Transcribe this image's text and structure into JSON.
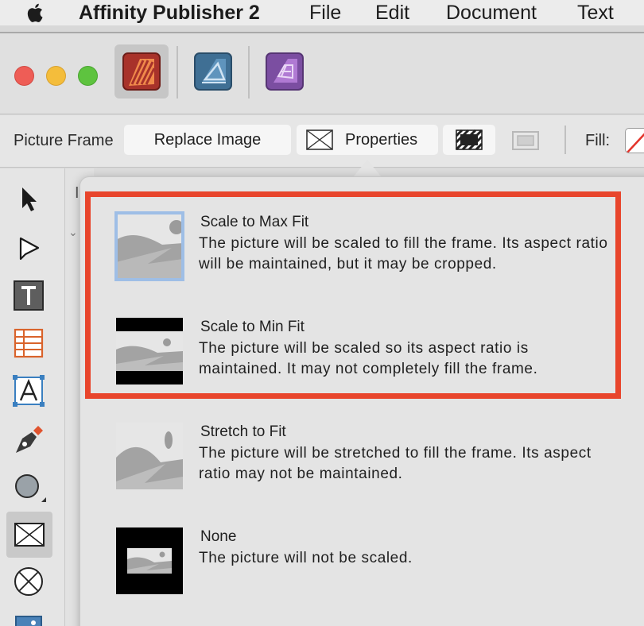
{
  "menubar": {
    "app_name": "Affinity Publisher 2",
    "items": [
      "File",
      "Edit",
      "Document",
      "Text"
    ]
  },
  "personas": [
    {
      "name": "publisher",
      "color": "#c24a2e",
      "selected": true
    },
    {
      "name": "designer",
      "color": "#3f6f94",
      "selected": false
    },
    {
      "name": "photo",
      "color": "#8d5bb0",
      "selected": false
    }
  ],
  "context_toolbar": {
    "label": "Picture Frame",
    "replace_image": "Replace Image",
    "properties": "Properties",
    "fill_label": "Fill:"
  },
  "behind_panel": {
    "tab_initial": "I",
    "chevron": "⌄"
  },
  "scale_options": [
    {
      "title": "Scale to Max Fit",
      "description": "The picture will be scaled to fill the frame. Its aspect ratio will be maintained, but it may be cropped.",
      "selected": true
    },
    {
      "title": "Scale to Min Fit",
      "description": "The picture will be scaled so its aspect ratio is maintained. It may not completely fill the frame.",
      "selected": false
    },
    {
      "title": "Stretch to Fit",
      "description": "The picture will be stretched to fill the frame. Its aspect ratio may not be maintained.",
      "selected": false
    },
    {
      "title": "None",
      "description": "The picture will not be scaled.",
      "selected": false
    }
  ],
  "colors": {
    "highlight": "#e8452c",
    "selection_outline": "#9ebee6"
  }
}
